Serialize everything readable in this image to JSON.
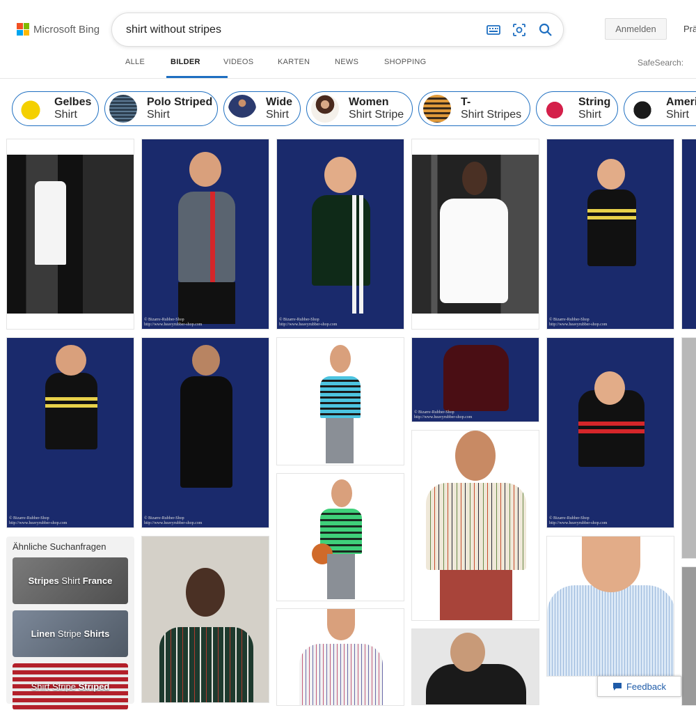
{
  "brand": {
    "logo_text": "Microsoft Bing"
  },
  "search": {
    "query": "shirt without stripes"
  },
  "account": {
    "signin_label": "Anmelden",
    "prefs_label": "Prä"
  },
  "nav": {
    "tabs": [
      "ALLE",
      "BILDER",
      "VIDEOS",
      "KARTEN",
      "NEWS",
      "SHOPPING"
    ],
    "active_tab": "BILDER",
    "safesearch_label": "SafeSearch:"
  },
  "chips": [
    {
      "bold": "Gelbes",
      "rest": "Shirt"
    },
    {
      "bold": "Polo Striped",
      "rest": "Shirt"
    },
    {
      "bold": "Wide",
      "rest": "Shirt"
    },
    {
      "bold": "Women",
      "rest": "Shirt Stripe"
    },
    {
      "bold": "T-",
      "rest": "Shirt Stripes"
    },
    {
      "bold": "String",
      "rest": "Shirt"
    },
    {
      "bold": "Americ",
      "rest": "Shirt"
    }
  ],
  "watermark": {
    "line1": "© Bizarre-Rubber-Shop",
    "line2": "http://www.heavyrubber-shop.com"
  },
  "related": {
    "title": "Ähnliche Suchanfragen",
    "items": [
      {
        "b1": "Stripes",
        "n": "Shirt",
        "b2": "France"
      },
      {
        "b1": "Linen",
        "n": "Stripe",
        "b2": "Shirts"
      },
      {
        "b1": "",
        "n": "Shirt Stripe",
        "b2": "Striped"
      }
    ]
  },
  "feedback": {
    "label": "Feedback"
  },
  "colors": {
    "accent": "#1e6fc1",
    "navy_bg": "#1a2a6c"
  }
}
